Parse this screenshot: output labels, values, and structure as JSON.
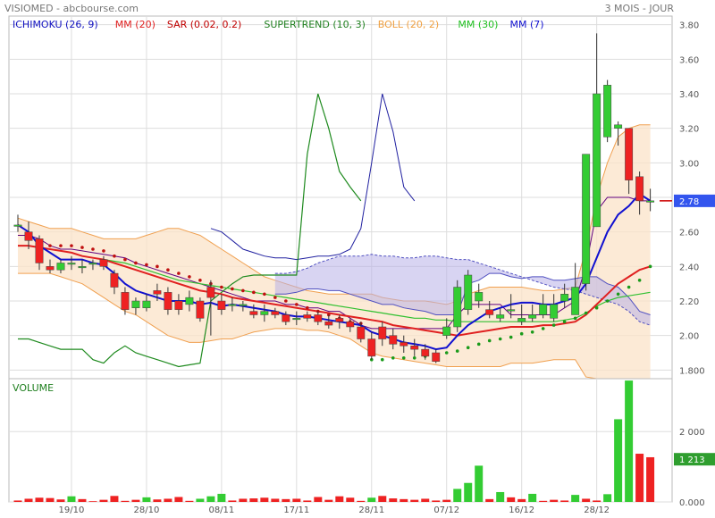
{
  "header": {
    "left": "VISIOMED - abcbourse.com",
    "right": "3 MOIS - JOUR"
  },
  "indicators": [
    {
      "label": "ICHIMOKU (26, 9)",
      "color": "#1010c0"
    },
    {
      "label": "MM (20)",
      "color": "#e02020"
    },
    {
      "label": "SAR (0.02, 0.2)",
      "color": "#c00000"
    },
    {
      "label": "SUPERTREND (10, 3)",
      "color": "#208020"
    },
    {
      "label": "BOLL (20, 2)",
      "color": "#f0a040"
    },
    {
      "label": "MM (30)",
      "color": "#20c020"
    },
    {
      "label": "MM (7)",
      "color": "#1010d0"
    }
  ],
  "colors": {
    "up": "#33cc33",
    "down": "#ee2222",
    "boll_fill": "#fbe3c8",
    "boll_line": "#f0a050",
    "cloud": "#b8b0e8",
    "grid": "#dddddd",
    "price_tag": "#3355ee"
  },
  "chart_data": [
    {
      "type": "candlestick",
      "yaxis_ticks": [
        "3.80",
        "3.60",
        "3.40",
        "3.20",
        "3.00",
        "2.80",
        "2.60",
        "2.40",
        "2.20",
        "2.00",
        "1.800"
      ],
      "yaxis_values": [
        3.8,
        3.6,
        3.4,
        3.2,
        3.0,
        2.8,
        2.6,
        2.4,
        2.2,
        2.0,
        1.8
      ],
      "ylim": [
        1.75,
        3.85
      ],
      "x_labels": [
        "19/10",
        "28/10",
        "08/11",
        "17/11",
        "28/11",
        "07/12",
        "16/12",
        "28/12"
      ],
      "x_label_index": [
        5,
        12,
        19,
        26,
        33,
        40,
        47,
        54
      ],
      "last_price_label": "2.78",
      "last_price": 2.78,
      "open": [
        2.64,
        2.6,
        2.56,
        2.4,
        2.38,
        2.42,
        2.4,
        2.42,
        2.44,
        2.36,
        2.25,
        2.16,
        2.16,
        2.26,
        2.25,
        2.2,
        2.18,
        2.2,
        2.28,
        2.2,
        2.18,
        2.18,
        2.14,
        2.12,
        2.14,
        2.12,
        2.1,
        2.12,
        2.12,
        2.08,
        2.1,
        2.08,
        2.05,
        1.98,
        2.05,
        2.0,
        1.96,
        1.94,
        1.92,
        1.9,
        2.0,
        2.05,
        2.15,
        2.2,
        2.15,
        2.1,
        2.15,
        2.08,
        2.1,
        2.12,
        2.1,
        2.2,
        2.12,
        2.3,
        2.63,
        3.15,
        3.2,
        3.2,
        2.92,
        2.78
      ],
      "close": [
        2.64,
        2.55,
        2.42,
        2.38,
        2.42,
        2.42,
        2.4,
        2.42,
        2.4,
        2.28,
        2.15,
        2.2,
        2.2,
        2.24,
        2.15,
        2.15,
        2.22,
        2.1,
        2.22,
        2.15,
        2.18,
        2.18,
        2.12,
        2.14,
        2.12,
        2.08,
        2.1,
        2.1,
        2.08,
        2.06,
        2.08,
        2.05,
        1.98,
        1.88,
        1.98,
        1.95,
        1.94,
        1.92,
        1.88,
        1.85,
        2.05,
        2.28,
        2.35,
        2.25,
        2.12,
        2.12,
        2.15,
        2.1,
        2.12,
        2.18,
        2.18,
        2.24,
        2.28,
        3.05,
        3.4,
        3.45,
        3.22,
        2.9,
        2.78,
        2.78
      ],
      "high": [
        2.7,
        2.66,
        2.58,
        2.44,
        2.44,
        2.46,
        2.44,
        2.44,
        2.46,
        2.38,
        2.28,
        2.22,
        2.24,
        2.3,
        2.28,
        2.24,
        2.26,
        2.22,
        2.32,
        2.24,
        2.22,
        2.2,
        2.18,
        2.18,
        2.16,
        2.14,
        2.14,
        2.14,
        2.14,
        2.12,
        2.12,
        2.1,
        2.08,
        2.02,
        2.08,
        2.04,
        2.0,
        1.98,
        1.95,
        1.92,
        2.1,
        2.32,
        2.38,
        2.3,
        2.2,
        2.16,
        2.24,
        2.18,
        2.18,
        2.24,
        2.24,
        2.3,
        2.42,
        3.05,
        3.75,
        3.48,
        3.24,
        3.2,
        2.95,
        2.85
      ],
      "low": [
        2.6,
        2.5,
        2.38,
        2.36,
        2.36,
        2.38,
        2.36,
        2.38,
        2.38,
        2.24,
        2.12,
        2.12,
        2.14,
        2.2,
        2.12,
        2.12,
        2.14,
        2.08,
        2.0,
        2.12,
        2.14,
        2.14,
        2.1,
        2.08,
        2.1,
        2.06,
        2.06,
        2.08,
        2.06,
        2.04,
        2.04,
        2.02,
        1.96,
        1.86,
        1.94,
        1.92,
        1.9,
        1.88,
        1.86,
        1.84,
        1.98,
        2.02,
        2.12,
        2.16,
        2.1,
        2.08,
        2.1,
        2.06,
        2.08,
        2.1,
        2.08,
        2.16,
        2.22,
        2.26,
        3.08,
        3.12,
        3.1,
        2.82,
        2.7,
        2.72
      ],
      "series": [
        {
          "name": "MM (7)",
          "values": [
            2.64,
            2.6,
            2.52,
            2.48,
            2.44,
            2.44,
            2.44,
            2.42,
            2.41,
            2.36,
            2.3,
            2.26,
            2.24,
            2.22,
            2.2,
            2.2,
            2.2,
            2.18,
            2.19,
            2.17,
            2.18,
            2.17,
            2.16,
            2.15,
            2.14,
            2.12,
            2.11,
            2.11,
            2.1,
            2.09,
            2.08,
            2.07,
            2.06,
            2.02,
            2.0,
            1.98,
            1.96,
            1.95,
            1.94,
            1.92,
            1.93,
            2.0,
            2.06,
            2.1,
            2.14,
            2.16,
            2.18,
            2.19,
            2.19,
            2.18,
            2.18,
            2.2,
            2.22,
            2.3,
            2.45,
            2.6,
            2.7,
            2.75,
            2.82,
            2.78
          ]
        },
        {
          "name": "MM (20)",
          "values": [
            2.52,
            2.52,
            2.51,
            2.5,
            2.49,
            2.48,
            2.46,
            2.45,
            2.44,
            2.42,
            2.4,
            2.38,
            2.36,
            2.34,
            2.32,
            2.3,
            2.28,
            2.26,
            2.25,
            2.24,
            2.22,
            2.21,
            2.2,
            2.19,
            2.18,
            2.17,
            2.16,
            2.15,
            2.14,
            2.13,
            2.12,
            2.11,
            2.1,
            2.09,
            2.08,
            2.06,
            2.05,
            2.04,
            2.03,
            2.02,
            2.01,
            2.0,
            2.01,
            2.02,
            2.03,
            2.04,
            2.05,
            2.05,
            2.05,
            2.06,
            2.06,
            2.07,
            2.08,
            2.12,
            2.18,
            2.24,
            2.3,
            2.34,
            2.38,
            2.4
          ]
        },
        {
          "name": "MM (30)",
          "values": [
            null,
            null,
            null,
            null,
            null,
            null,
            2.46,
            2.45,
            2.44,
            2.43,
            2.42,
            2.4,
            2.38,
            2.36,
            2.34,
            2.32,
            2.31,
            2.3,
            2.29,
            2.28,
            2.27,
            2.26,
            2.25,
            2.24,
            2.23,
            2.22,
            2.21,
            2.2,
            2.19,
            2.18,
            2.17,
            2.16,
            2.15,
            2.14,
            2.13,
            2.12,
            2.11,
            2.1,
            2.1,
            2.09,
            2.09,
            2.08,
            2.08,
            2.08,
            2.08,
            2.08,
            2.08,
            2.08,
            2.08,
            2.08,
            2.08,
            2.09,
            2.1,
            2.13,
            2.17,
            2.2,
            2.22,
            2.23,
            2.24,
            2.25
          ]
        },
        {
          "name": "BOLL upper",
          "values": [
            2.68,
            2.66,
            2.64,
            2.62,
            2.62,
            2.62,
            2.6,
            2.58,
            2.56,
            2.56,
            2.56,
            2.56,
            2.58,
            2.6,
            2.62,
            2.62,
            2.6,
            2.58,
            2.54,
            2.5,
            2.46,
            2.42,
            2.38,
            2.34,
            2.32,
            2.3,
            2.28,
            2.26,
            2.25,
            2.24,
            2.24,
            2.24,
            2.24,
            2.24,
            2.22,
            2.21,
            2.2,
            2.2,
            2.2,
            2.19,
            2.18,
            2.2,
            2.24,
            2.26,
            2.28,
            2.28,
            2.28,
            2.28,
            2.27,
            2.26,
            2.26,
            2.27,
            2.28,
            2.5,
            2.8,
            3.0,
            3.15,
            3.2,
            3.22,
            3.22
          ]
        },
        {
          "name": "BOLL lower",
          "values": [
            2.36,
            2.36,
            2.36,
            2.36,
            2.34,
            2.32,
            2.3,
            2.26,
            2.22,
            2.18,
            2.14,
            2.12,
            2.08,
            2.04,
            2.0,
            1.98,
            1.96,
            1.96,
            1.97,
            1.98,
            1.98,
            2.0,
            2.02,
            2.03,
            2.04,
            2.04,
            2.04,
            2.03,
            2.03,
            2.02,
            2.0,
            1.98,
            1.94,
            1.9,
            1.88,
            1.87,
            1.86,
            1.85,
            1.84,
            1.83,
            1.82,
            1.82,
            1.82,
            1.82,
            1.82,
            1.82,
            1.84,
            1.84,
            1.84,
            1.85,
            1.86,
            1.86,
            1.86,
            1.76,
            1.75,
            1.75,
            1.75,
            1.75,
            1.75,
            1.75
          ]
        },
        {
          "name": "SUPERTREND (10, 3)",
          "values": [
            1.98,
            1.98,
            1.96,
            1.94,
            1.92,
            1.92,
            1.92,
            1.86,
            1.84,
            1.9,
            1.94,
            1.9,
            1.88,
            1.86,
            1.84,
            1.82,
            1.83,
            1.84,
            2.2,
            2.25,
            2.3,
            2.34,
            2.35,
            2.35,
            2.35,
            2.35,
            2.35,
            3.05,
            3.4,
            3.2,
            2.95,
            2.86,
            2.78
          ]
        }
      ],
      "sar": [
        null,
        null,
        null,
        2.52,
        2.52,
        2.52,
        2.51,
        2.5,
        2.49,
        2.46,
        2.44,
        2.42,
        2.41,
        2.4,
        2.38,
        2.36,
        2.34,
        2.32,
        2.3,
        2.28,
        2.27,
        2.26,
        2.25,
        2.24,
        2.22,
        2.2,
        2.18,
        2.16,
        2.14,
        2.12,
        2.1,
        2.08,
        2.07,
        1.86,
        1.86,
        1.87,
        1.87,
        1.87,
        1.88,
        1.88,
        1.9,
        1.91,
        1.93,
        1.95,
        1.97,
        1.98,
        1.99,
        2.01,
        2.02,
        2.04,
        2.06,
        2.08,
        2.1,
        2.13,
        2.16,
        2.2,
        2.24,
        2.28,
        2.32,
        2.4
      ],
      "ichimoku_kijun": [
        2.58,
        2.58,
        2.56,
        2.52,
        2.5,
        2.5,
        2.49,
        2.48,
        2.47,
        2.46,
        2.45,
        2.42,
        2.4,
        2.38,
        2.36,
        2.34,
        2.32,
        2.3,
        2.28,
        2.26,
        2.24,
        2.22,
        2.2,
        2.2,
        2.2,
        2.18,
        2.18,
        2.16,
        2.16,
        2.14,
        2.14,
        2.1,
        2.06,
        2.04,
        2.04,
        2.04,
        2.04,
        2.04,
        2.04,
        2.04,
        2.04,
        2.12,
        2.18,
        2.18,
        2.18,
        2.18,
        2.12,
        2.12,
        2.12,
        2.12,
        2.12,
        2.16,
        2.2,
        2.4,
        2.72,
        2.8,
        2.8,
        2.8,
        2.78,
        2.78
      ],
      "ichimoku_span_a": [
        2.24,
        2.24,
        2.25,
        2.27,
        2.27,
        2.26,
        2.26,
        2.24,
        2.22,
        2.2,
        2.18,
        2.18,
        2.16,
        2.15,
        2.14,
        2.12,
        2.12,
        2.12,
        2.3,
        2.32,
        2.36,
        2.36,
        2.34,
        2.33,
        2.34,
        2.34,
        2.32,
        2.32,
        2.33,
        2.34,
        2.34,
        2.3,
        2.28,
        2.22,
        2.14,
        2.12
      ],
      "ichimoku_span_b": [
        2.36,
        2.36,
        2.37,
        2.39,
        2.42,
        2.44,
        2.46,
        2.46,
        2.46,
        2.47,
        2.46,
        2.46,
        2.45,
        2.45,
        2.46,
        2.46,
        2.45,
        2.44,
        2.44,
        2.42,
        2.4,
        2.38,
        2.36,
        2.34,
        2.32,
        2.3,
        2.28,
        2.27,
        2.26,
        2.24,
        2.22,
        2.2,
        2.18,
        2.14,
        2.08,
        2.06
      ],
      "ichimoku_chikou": [
        2.62,
        2.6,
        2.55,
        2.5,
        2.48,
        2.46,
        2.45,
        2.45,
        2.44,
        2.45,
        2.46,
        2.46,
        2.47,
        2.5,
        2.62,
        3.0,
        3.4,
        3.18,
        2.86,
        2.78
      ]
    },
    {
      "type": "bar",
      "title": "VOLUME",
      "yaxis_ticks": [
        "2 000",
        "0.000"
      ],
      "yaxis_values": [
        2000,
        0
      ],
      "ylim": [
        0,
        3300
      ],
      "last_volume_label": "1 213",
      "last_volume": 1213,
      "values": [
        40,
        90,
        120,
        110,
        70,
        160,
        80,
        20,
        60,
        170,
        30,
        60,
        130,
        70,
        90,
        140,
        30,
        90,
        160,
        230,
        40,
        90,
        100,
        120,
        90,
        80,
        90,
        40,
        140,
        60,
        160,
        120,
        30,
        120,
        170,
        100,
        80,
        60,
        90,
        40,
        60,
        370,
        540,
        1030,
        80,
        280,
        130,
        80,
        230,
        30,
        60,
        40,
        200,
        90,
        40,
        220,
        2350,
        3450,
        1370,
        1270,
        1213
      ],
      "colors_up": [
        0,
        0,
        0,
        0,
        0,
        1,
        0,
        0,
        0,
        0,
        0,
        0,
        1,
        0,
        0,
        0,
        0,
        1,
        1,
        1,
        0,
        0,
        0,
        0,
        0,
        0,
        0,
        0,
        0,
        0,
        0,
        0,
        0,
        1,
        0,
        0,
        0,
        0,
        0,
        0,
        0,
        1,
        1,
        1,
        0,
        1,
        0,
        0,
        1,
        0,
        0,
        0,
        1,
        0,
        0,
        1,
        1,
        1,
        0,
        0,
        0
      ]
    }
  ]
}
